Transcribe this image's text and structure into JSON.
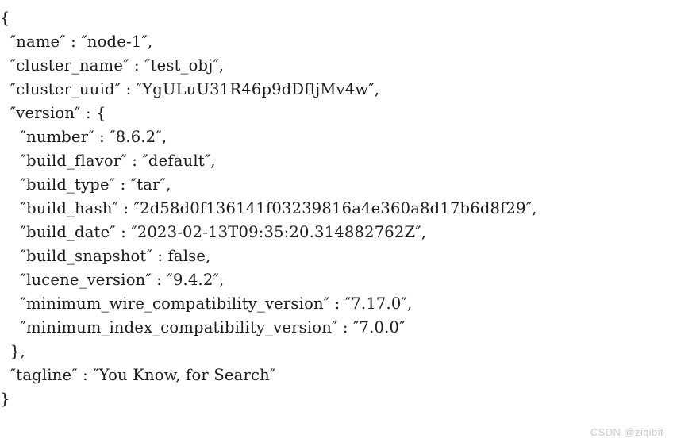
{
  "document": {
    "type": "json-response",
    "background_color": "#ffffff",
    "text_color": "#1a1a1a",
    "quote_glyph": "″",
    "lines": [
      "{",
      "  ″name″ : ″node-1″,",
      "  ″cluster_name″ : ″test_obj″,",
      "  ″cluster_uuid″ : ″YgULuU31R46p9dDfljMv4w″,",
      "  ″version″ : {",
      "    ″number″ : ″8.6.2″,",
      "    ″build_flavor″ : ″default″,",
      "    ″build_type″ : ″tar″,",
      "    ″build_hash″ : ″2d58d0f136141f03239816a4e360a8d17b6d8f29″,",
      "    ″build_date″ : ″2023-02-13T09:35:20.314882762Z″,",
      "    ″build_snapshot″ : false,",
      "    ″lucene_version″ : ″9.4.2″,",
      "    ″minimum_wire_compatibility_version″ : ″7.17.0″,",
      "    ″minimum_index_compatibility_version″ : ″7.0.0″",
      "  },",
      "  ″tagline″ : ″You Know, for Search″",
      "}"
    ],
    "values": {
      "name": "node-1",
      "cluster_name": "test_obj",
      "cluster_uuid": "YgULuU31R46p9dDfljMv4w",
      "version": {
        "number": "8.6.2",
        "build_flavor": "default",
        "build_type": "tar",
        "build_hash": "2d58d0f136141f03239816a4e360a8d17b6d8f29",
        "build_date": "2023-02-13T09:35:20.314882762Z",
        "build_snapshot": "false",
        "lucene_version": "9.4.2",
        "minimum_wire_compatibility_version": "7.17.0",
        "minimum_index_compatibility_version": "7.0.0"
      },
      "tagline": "You Know, for Search"
    }
  },
  "watermark": {
    "text": "CSDN @ziqibit",
    "color": "#c9c9c9"
  }
}
